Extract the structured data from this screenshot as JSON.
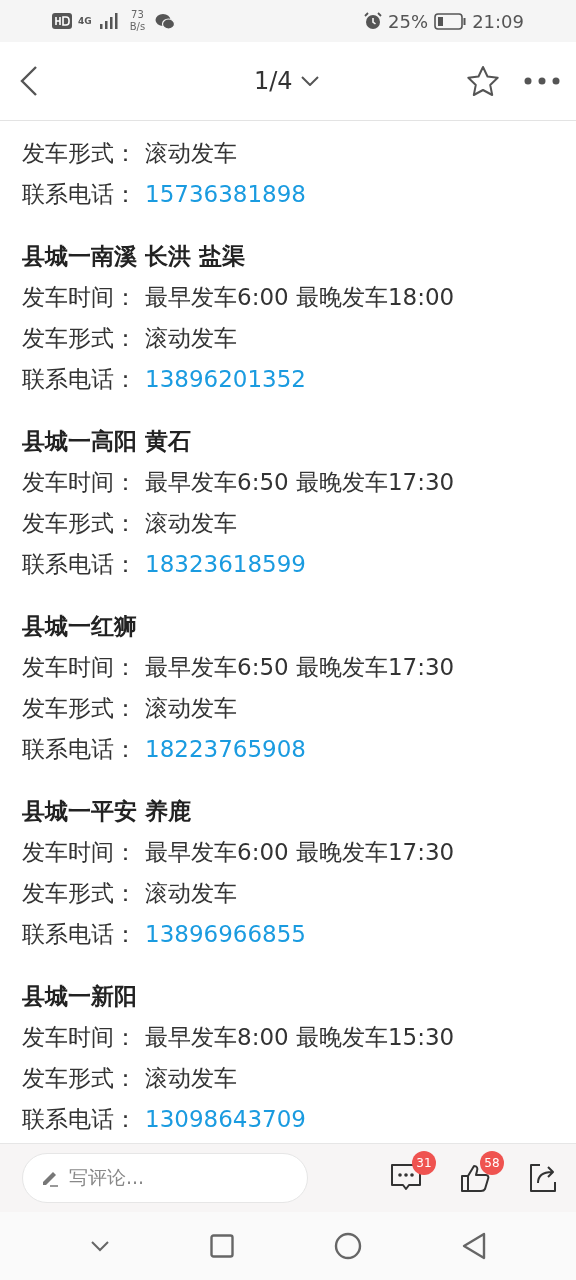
{
  "status_bar": {
    "network_type": "4G",
    "speed_value": "73",
    "speed_unit": "B/s",
    "battery": "25%",
    "time": "21:09"
  },
  "header": {
    "page_indicator": "1/4"
  },
  "partial_route": {
    "rows": [
      {
        "label": "发车形式：",
        "value": "滚动发车",
        "kind": "text"
      },
      {
        "label": "联系电话：",
        "value": "15736381898",
        "kind": "phone"
      }
    ]
  },
  "routes": [
    {
      "title": "县城一南溪 长洪 盐渠",
      "rows": [
        {
          "label": "发车时间：",
          "value": "最早发车6:00 最晚发车18:00",
          "kind": "text"
        },
        {
          "label": "发车形式：",
          "value": "滚动发车",
          "kind": "text"
        },
        {
          "label": "联系电话：",
          "value": "13896201352",
          "kind": "phone"
        }
      ]
    },
    {
      "title": "县城一高阳 黄石",
      "rows": [
        {
          "label": "发车时间：",
          "value": "最早发车6:50 最晚发车17:30",
          "kind": "text"
        },
        {
          "label": "发车形式：",
          "value": "滚动发车",
          "kind": "text"
        },
        {
          "label": "联系电话：",
          "value": "18323618599",
          "kind": "phone"
        }
      ]
    },
    {
      "title": "县城一红狮",
      "rows": [
        {
          "label": "发车时间：",
          "value": "最早发车6:50 最晚发车17:30",
          "kind": "text"
        },
        {
          "label": "发车形式：",
          "value": "滚动发车",
          "kind": "text"
        },
        {
          "label": "联系电话：",
          "value": "18223765908",
          "kind": "phone"
        }
      ]
    },
    {
      "title": "县城一平安 养鹿",
      "rows": [
        {
          "label": "发车时间：",
          "value": "最早发车6:00 最晚发车17:30",
          "kind": "text"
        },
        {
          "label": "发车形式：",
          "value": "滚动发车",
          "kind": "text"
        },
        {
          "label": "联系电话：",
          "value": "13896966855",
          "kind": "phone"
        }
      ]
    },
    {
      "title": "县城一新阳",
      "rows": [
        {
          "label": "发车时间：",
          "value": "最早发车8:00 最晚发车15:30",
          "kind": "text"
        },
        {
          "label": "发车形式：",
          "value": "滚动发车",
          "kind": "text"
        },
        {
          "label": "联系电话：",
          "value": "13098643709",
          "kind": "phone"
        }
      ]
    }
  ],
  "bottom_bar": {
    "comment_placeholder": "写评论...",
    "comment_count": "31",
    "like_count": "58"
  }
}
